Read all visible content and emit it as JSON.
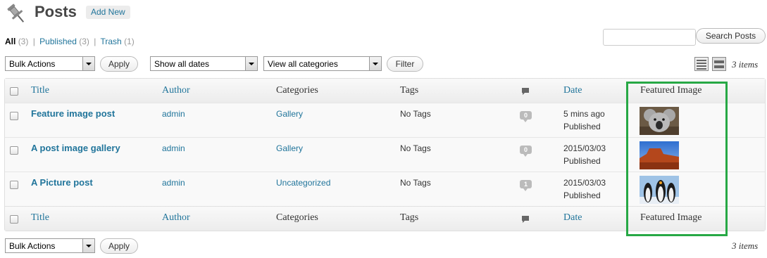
{
  "header": {
    "title": "Posts",
    "add_new": "Add New"
  },
  "filters": {
    "all": "All",
    "all_count": "(3)",
    "published": "Published",
    "published_count": "(3)",
    "trash": "Trash",
    "trash_count": "(1)"
  },
  "search": {
    "value": "",
    "button": "Search Posts"
  },
  "toolbar_top": {
    "bulk_actions": "Bulk Actions",
    "apply": "Apply",
    "dates": "Show all dates",
    "categories": "View all categories",
    "filter": "Filter",
    "items": "3 items"
  },
  "toolbar_bottom": {
    "bulk_actions": "Bulk Actions",
    "apply": "Apply",
    "items": "3 items"
  },
  "columns": {
    "title": "Title",
    "author": "Author",
    "categories": "Categories",
    "tags": "Tags",
    "date": "Date",
    "featured_image": "Featured Image"
  },
  "posts": [
    {
      "title": "Feature image post",
      "author": "admin",
      "category": "Gallery",
      "tags": "No Tags",
      "comments": "0",
      "date": "5 mins ago",
      "status": "Published",
      "image": "koala"
    },
    {
      "title": "A post image gallery",
      "author": "admin",
      "category": "Gallery",
      "tags": "No Tags",
      "comments": "0",
      "date": "2015/03/03",
      "status": "Published",
      "image": "desert"
    },
    {
      "title": "A Picture post",
      "author": "admin",
      "category": "Uncategorized",
      "tags": "No Tags",
      "comments": "1",
      "date": "2015/03/03",
      "status": "Published",
      "image": "penguins"
    }
  ],
  "colors": {
    "link": "#21759b",
    "highlight": "#27a845"
  },
  "icons": {
    "page": "pushpin-icon",
    "comments": "comment-bubble-icon"
  }
}
